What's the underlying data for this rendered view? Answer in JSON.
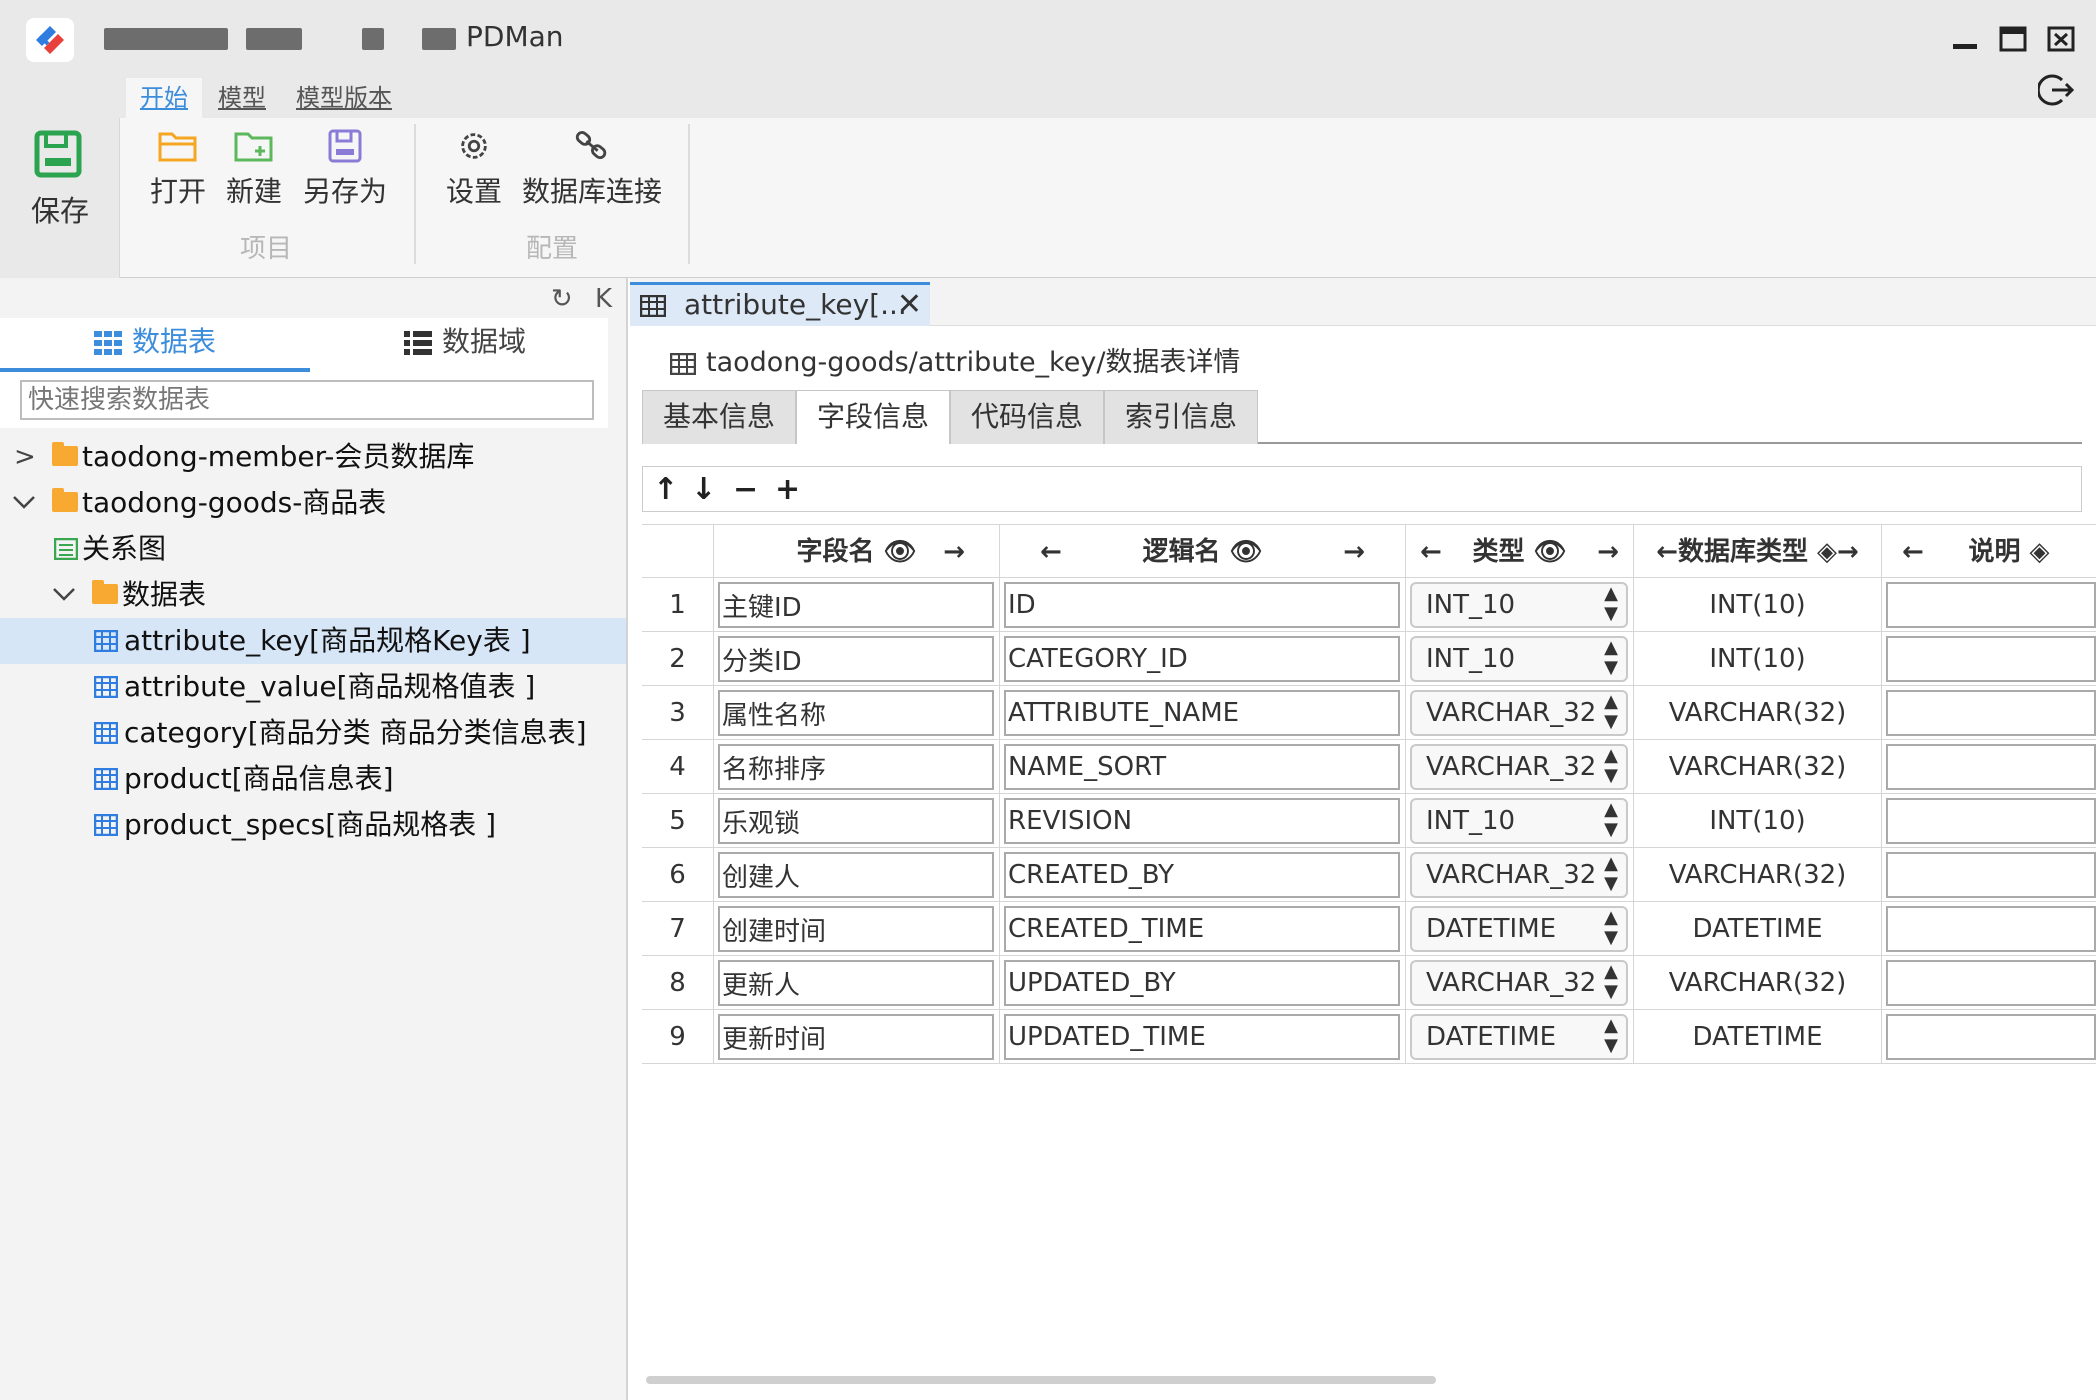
{
  "window": {
    "app_title": "PDMan"
  },
  "ribbon": {
    "tabs": [
      "开始",
      "模型",
      "模型版本"
    ],
    "active_tab": "开始",
    "save_label": "保存",
    "buttons": {
      "open": "打开",
      "new": "新建",
      "save_as": "另存为",
      "settings": "设置",
      "db_connect": "数据库连接"
    },
    "groups": {
      "project": "项目",
      "config": "配置"
    },
    "colors": {
      "accent": "#3c8ddc",
      "save_icon": "#2aa44f"
    }
  },
  "left_panel": {
    "tabs": [
      "数据表",
      "数据域"
    ],
    "active_tab": "数据表",
    "search_placeholder": "快速搜索数据表",
    "tree": [
      {
        "level": 0,
        "caret": ">",
        "icon": "folder-icon",
        "label": "taodong-member-会员数据库"
      },
      {
        "level": 0,
        "caret": "v",
        "icon": "folder-icon",
        "label": "taodong-goods-商品表"
      },
      {
        "level": 1,
        "caret": "",
        "icon": "relation-icon",
        "label": "关系图"
      },
      {
        "level": 1,
        "caret": "v",
        "icon": "folder-icon",
        "label": "数据表"
      },
      {
        "level": 2,
        "caret": "",
        "icon": "table-icon",
        "label": "attribute_key[商品规格Key表 ]",
        "selected": true
      },
      {
        "level": 2,
        "caret": "",
        "icon": "table-icon",
        "label": "attribute_value[商品规格值表 ]"
      },
      {
        "level": 2,
        "caret": "",
        "icon": "table-icon",
        "label": "category[商品分类 商品分类信息表]"
      },
      {
        "level": 2,
        "caret": "",
        "icon": "table-icon",
        "label": "product[商品信息表]"
      },
      {
        "level": 2,
        "caret": "",
        "icon": "table-icon",
        "label": "product_specs[商品规格表 ]"
      }
    ]
  },
  "editor": {
    "doc_tab": "attribute_key[...",
    "breadcrumb": "taodong-goods/attribute_key/数据表详情",
    "sub_tabs": [
      "基本信息",
      "字段信息",
      "代码信息",
      "索引信息"
    ],
    "active_sub_tab": "字段信息",
    "toolbar": [
      "↑",
      "↓",
      "−",
      "+"
    ],
    "columns": {
      "field_name": "字段名",
      "logical_name": "逻辑名",
      "type": "类型",
      "db_type": "数据库类型",
      "comment": "说明"
    },
    "rows": [
      {
        "n": "1",
        "field": "主键ID",
        "logical": "ID",
        "type": "INT_10",
        "db_type": "INT(10)"
      },
      {
        "n": "2",
        "field": "分类ID",
        "logical": "CATEGORY_ID",
        "type": "INT_10",
        "db_type": "INT(10)"
      },
      {
        "n": "3",
        "field": "属性名称",
        "logical": "ATTRIBUTE_NAME",
        "type": "VARCHAR_32",
        "db_type": "VARCHAR(32)"
      },
      {
        "n": "4",
        "field": "名称排序",
        "logical": "NAME_SORT",
        "type": "VARCHAR_32",
        "db_type": "VARCHAR(32)"
      },
      {
        "n": "5",
        "field": "乐观锁",
        "logical": "REVISION",
        "type": "INT_10",
        "db_type": "INT(10)"
      },
      {
        "n": "6",
        "field": "创建人",
        "logical": "CREATED_BY",
        "type": "VARCHAR_32",
        "db_type": "VARCHAR(32)"
      },
      {
        "n": "7",
        "field": "创建时间",
        "logical": "CREATED_TIME",
        "type": "DATETIME",
        "db_type": "DATETIME"
      },
      {
        "n": "8",
        "field": "更新人",
        "logical": "UPDATED_BY",
        "type": "VARCHAR_32",
        "db_type": "VARCHAR(32)"
      },
      {
        "n": "9",
        "field": "更新时间",
        "logical": "UPDATED_TIME",
        "type": "DATETIME",
        "db_type": "DATETIME"
      }
    ]
  }
}
